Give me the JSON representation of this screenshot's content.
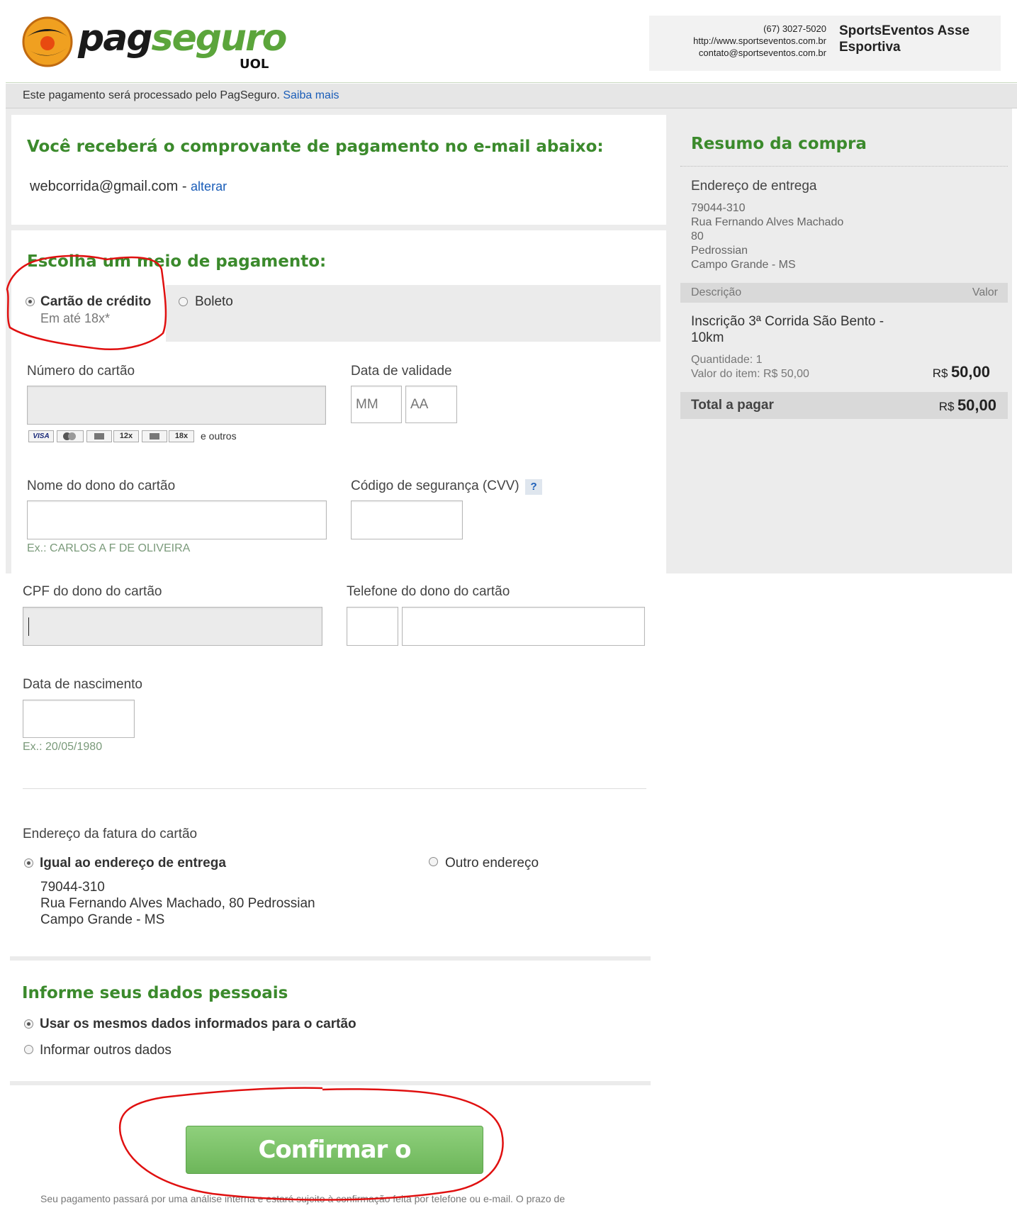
{
  "header": {
    "logo_text_pag": "pag",
    "logo_text_seguro": "seguro",
    "logo_sub": "UOL",
    "merchant": {
      "phone": "(67) 3027-5020",
      "url": "http://www.sportseventos.com.br",
      "email": "contato@sportseventos.com.br",
      "name_line1": "SportsEventos Asse",
      "name_line2": "Esportiva"
    }
  },
  "notice": {
    "text": "Este pagamento será processado pelo PagSeguro. ",
    "link": "Saiba mais"
  },
  "email_section": {
    "title": "Você receberá o comprovante de pagamento no e-mail abaixo:",
    "email": "webcorrida@gmail.com",
    "separator": " - ",
    "change_link": "alterar"
  },
  "payment_method": {
    "title": "Escolha um meio de pagamento:",
    "options": [
      {
        "label": "Cartão de crédito",
        "sub": "Em até 18x*",
        "selected": true
      },
      {
        "label": "Boleto",
        "selected": false
      }
    ]
  },
  "card_form": {
    "card_number_label": "Número do cartão",
    "card_badges": [
      "VISA",
      "12x",
      "18x"
    ],
    "card_badges_tail": "e outros",
    "expiry_label": "Data de validade",
    "expiry_month_placeholder": "MM",
    "expiry_year_placeholder": "AA",
    "holder_label": "Nome do dono do cartão",
    "holder_hint": "Ex.: CARLOS A F DE OLIVEIRA",
    "cvv_label": "Código de segurança (CVV)",
    "cvv_help": "?",
    "cpf_label": "CPF do dono do cartão",
    "phone_label": "Telefone do dono do cartão",
    "birth_label": "Data de nascimento",
    "birth_hint": "Ex.: 20/05/1980"
  },
  "billing": {
    "title": "Endereço da fatura do cartão",
    "same_label": "Igual ao endereço de entrega",
    "other_label": "Outro endereço",
    "address_line1": "79044-310",
    "address_line2": "Rua Fernando Alves Machado, 80 Pedrossian",
    "address_line3": "Campo Grande - MS"
  },
  "personal": {
    "title": "Informe seus dados pessoais",
    "same_label": "Usar os mesmos dados informados para o cartão",
    "other_label": "Informar outros dados"
  },
  "confirm_button": "Confirmar o pagamento",
  "footer_text": "Seu pagamento passará por uma análise interna e estará sujeito à confirmação feita por telefone ou e-mail. O prazo de",
  "summary": {
    "title": "Resumo da compra",
    "address_title": "Endereço de entrega",
    "address_lines": [
      "79044-310",
      "Rua Fernando Alves Machado",
      "80",
      "Pedrossian",
      "Campo Grande - MS"
    ],
    "col_description": "Descrição",
    "col_value": "Valor",
    "item_name_line1": "Inscrição 3ª Corrida São Bento -",
    "item_name_line2": "10km",
    "item_qty": "Quantidade: 1",
    "item_unit": "Valor do item: R$ 50,00",
    "currency": "R$",
    "item_total": "50,00",
    "total_label": "Total a pagar",
    "total_value": "50,00"
  },
  "colors": {
    "accent_green": "#3b8a2c",
    "button_green": "#7cc56b",
    "annotation_red": "#e01010",
    "link_blue": "#1a5db8"
  }
}
